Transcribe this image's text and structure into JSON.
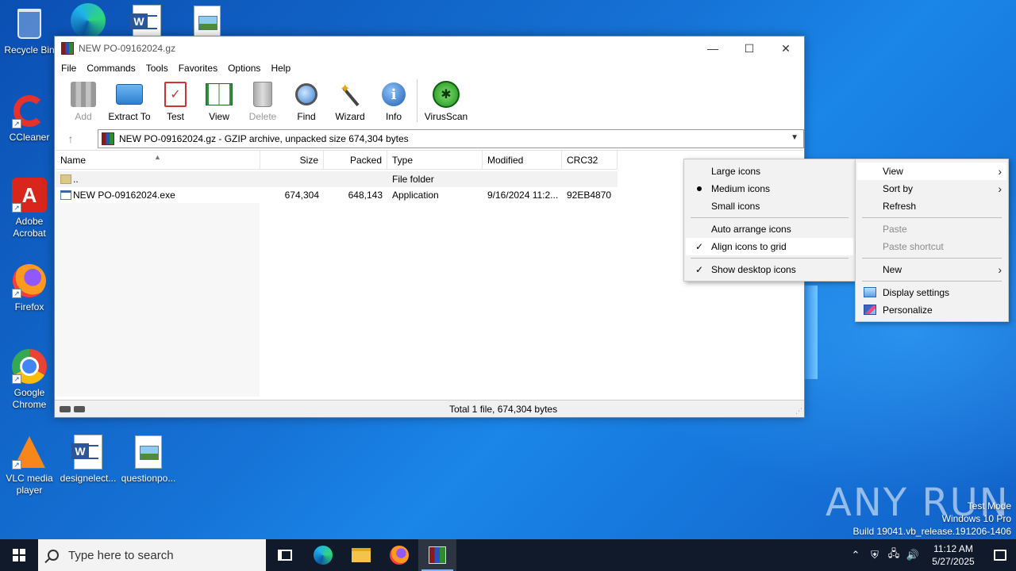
{
  "desktop": {
    "icons": [
      {
        "label": "Recycle Bin"
      },
      {
        "label": "CCleaner"
      },
      {
        "label": "Adobe Acrobat"
      },
      {
        "label": "Firefox"
      },
      {
        "label": "Google Chrome"
      },
      {
        "label": "VLC media player"
      },
      {
        "label": "designelect..."
      },
      {
        "label": "questionpo..."
      }
    ]
  },
  "window": {
    "title": "NEW PO-09162024.gz",
    "controls": {
      "minimize": "—",
      "maximize": "☐",
      "close": "✕"
    },
    "menu": [
      "File",
      "Commands",
      "Tools",
      "Favorites",
      "Options",
      "Help"
    ],
    "toolbar": [
      {
        "label": "Add",
        "icon": "add-icon",
        "disabled": true
      },
      {
        "label": "Extract To",
        "icon": "extract-icon",
        "disabled": false
      },
      {
        "label": "Test",
        "icon": "test-icon",
        "disabled": false
      },
      {
        "label": "View",
        "icon": "view-icon",
        "disabled": false
      },
      {
        "label": "Delete",
        "icon": "delete-icon",
        "disabled": true
      },
      {
        "label": "Find",
        "icon": "find-icon",
        "disabled": false
      },
      {
        "label": "Wizard",
        "icon": "wizard-icon",
        "disabled": false
      },
      {
        "label": "Info",
        "icon": "info-icon",
        "disabled": false
      },
      {
        "label": "VirusScan",
        "icon": "virusscan-icon",
        "disabled": false
      }
    ],
    "address": "NEW PO-09162024.gz - GZIP archive, unpacked size 674,304 bytes",
    "columns": [
      "Name",
      "Size",
      "Packed",
      "Type",
      "Modified",
      "CRC32"
    ],
    "rows": [
      {
        "name": "..",
        "size": "",
        "packed": "",
        "type": "File folder",
        "modified": "",
        "crc": ""
      },
      {
        "name": "NEW PO-09162024.exe",
        "size": "674,304",
        "packed": "648,143",
        "type": "Application",
        "modified": "9/16/2024 11:2...",
        "crc": "92EB4870"
      }
    ],
    "status": "Total 1 file, 674,304 bytes"
  },
  "context_menu": {
    "items": [
      {
        "label": "View",
        "submenu": true
      },
      {
        "label": "Sort by",
        "submenu": true
      },
      {
        "label": "Refresh"
      },
      {
        "label": "Paste",
        "disabled": true
      },
      {
        "label": "Paste shortcut",
        "disabled": true
      },
      {
        "label": "New",
        "submenu": true
      },
      {
        "label": "Display settings"
      },
      {
        "label": "Personalize"
      }
    ]
  },
  "view_submenu": {
    "items": [
      {
        "label": "Large icons"
      },
      {
        "label": "Medium icons",
        "selected": true
      },
      {
        "label": "Small icons"
      },
      {
        "label": "Auto arrange icons"
      },
      {
        "label": "Align icons to grid",
        "checked": true
      },
      {
        "label": "Show desktop icons",
        "checked": true
      }
    ]
  },
  "watermark": {
    "brand": "ANY RUN",
    "line1": "Test Mode",
    "line2": "Windows 10 Pro",
    "line3": "Build 19041.vb_release.191206-1406"
  },
  "taskbar": {
    "search_placeholder": "Type here to search",
    "time": "11:12 AM",
    "date": "5/27/2025"
  }
}
